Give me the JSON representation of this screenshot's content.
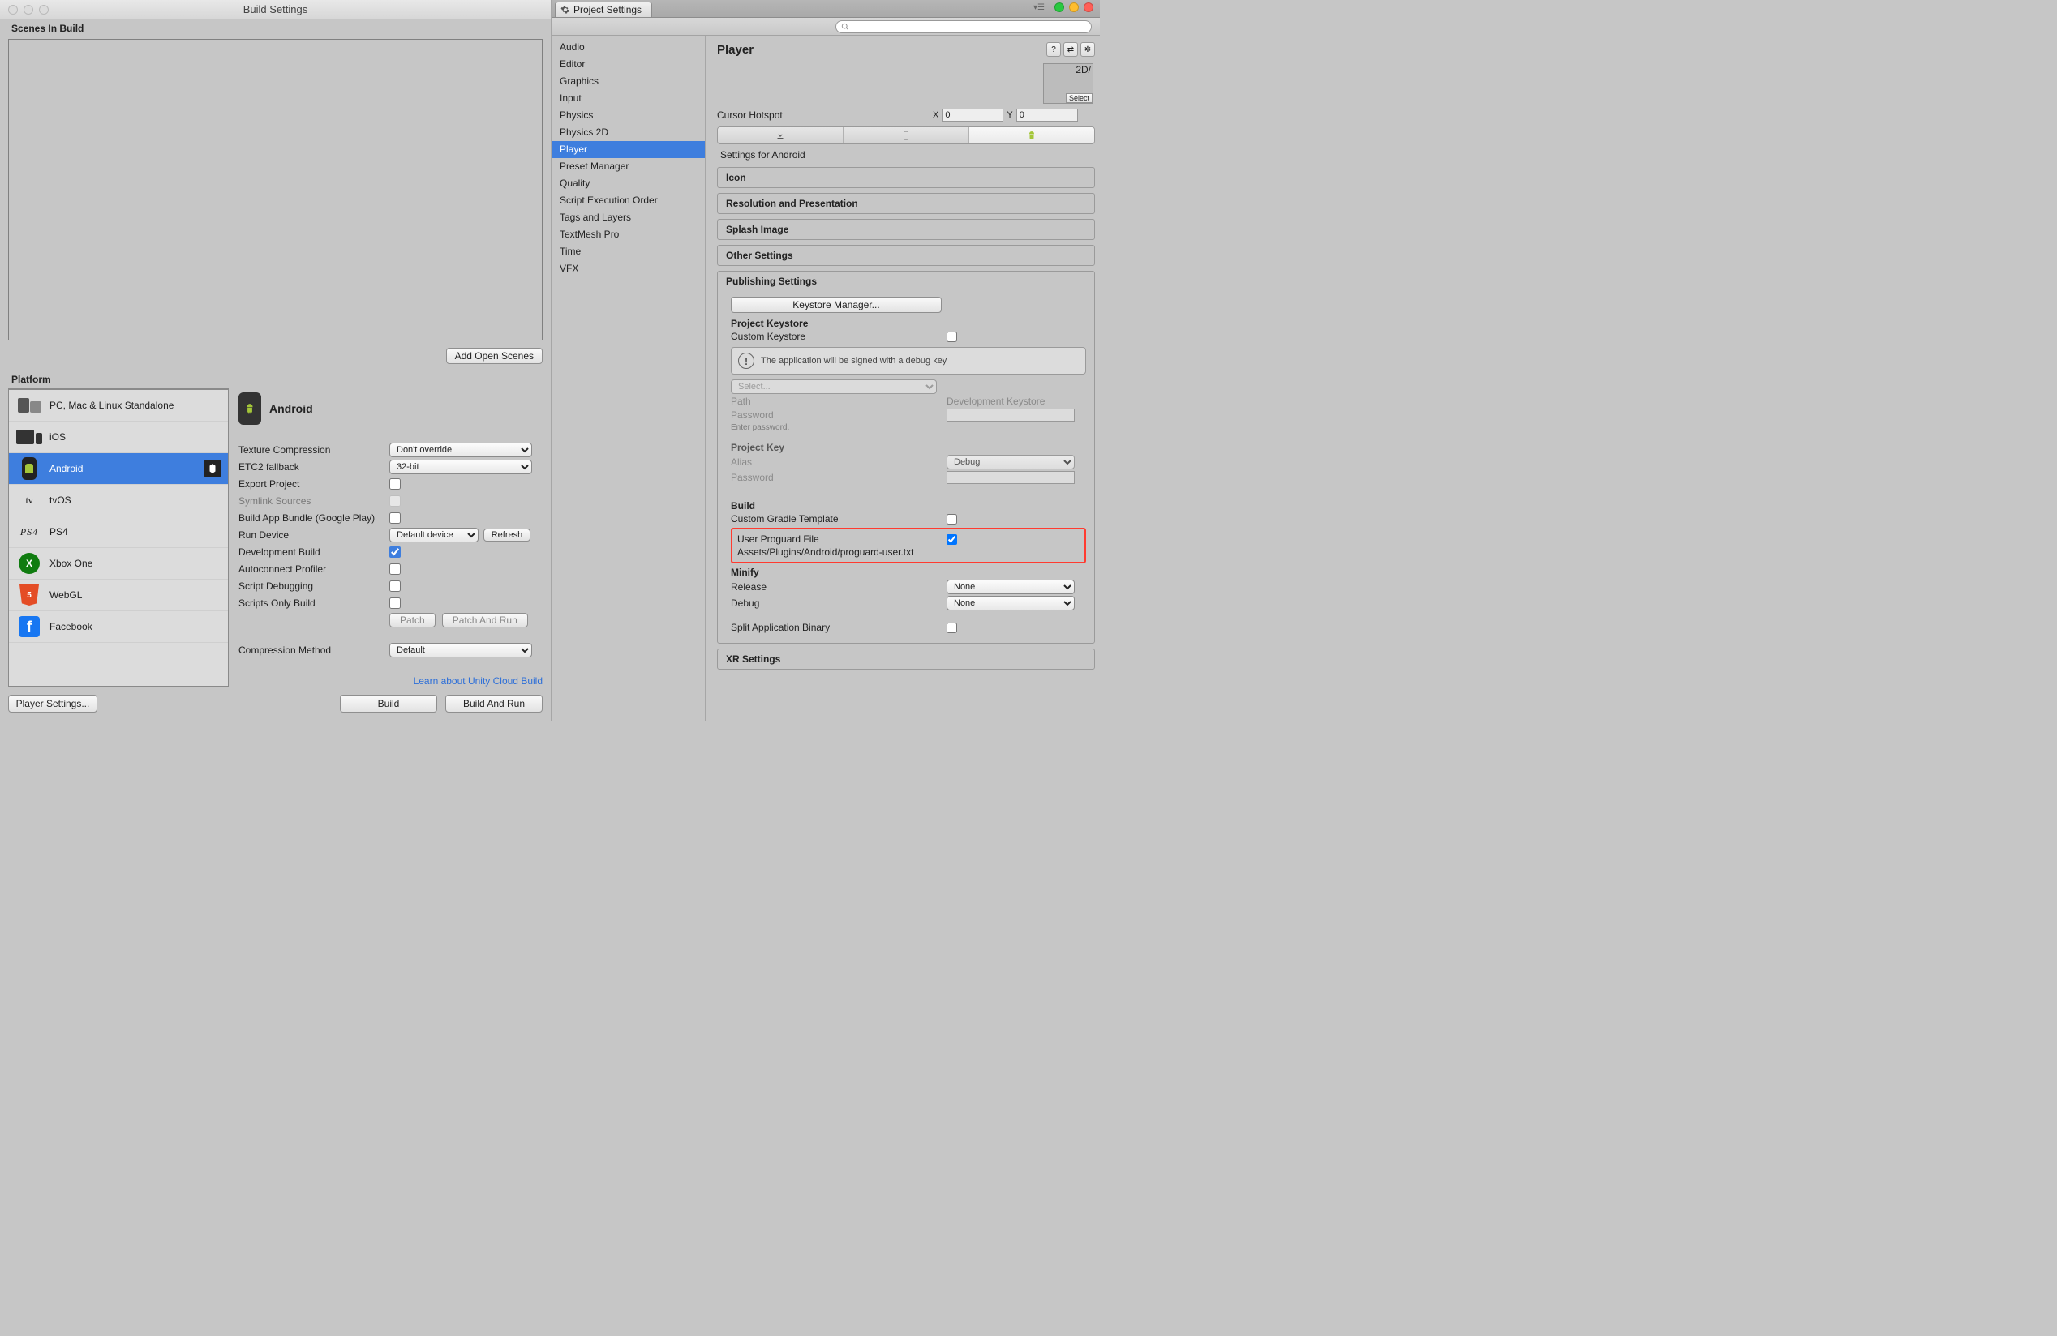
{
  "buildSettings": {
    "windowTitle": "Build Settings",
    "scenesLabel": "Scenes In Build",
    "addOpenScenes": "Add Open Scenes",
    "platformLabel": "Platform",
    "platforms": [
      {
        "label": "PC, Mac & Linux Standalone"
      },
      {
        "label": "iOS"
      },
      {
        "label": "Android"
      },
      {
        "label": "tvOS"
      },
      {
        "label": "PS4"
      },
      {
        "label": "Xbox One"
      },
      {
        "label": "WebGL"
      },
      {
        "label": "Facebook"
      }
    ],
    "selectedPlatform": "Android",
    "options": {
      "textureCompression": {
        "label": "Texture Compression",
        "value": "Don't override"
      },
      "etc2": {
        "label": "ETC2 fallback",
        "value": "32-bit"
      },
      "exportProject": {
        "label": "Export Project",
        "checked": false
      },
      "symlink": {
        "label": "Symlink Sources",
        "checked": false,
        "disabled": true
      },
      "aab": {
        "label": "Build App Bundle (Google Play)",
        "checked": false
      },
      "runDevice": {
        "label": "Run Device",
        "value": "Default device",
        "refresh": "Refresh"
      },
      "devBuild": {
        "label": "Development Build",
        "checked": true
      },
      "autoconnect": {
        "label": "Autoconnect Profiler",
        "checked": false
      },
      "scriptDebug": {
        "label": "Script Debugging",
        "checked": false
      },
      "scriptsOnly": {
        "label": "Scripts Only Build",
        "checked": false,
        "patch": "Patch",
        "patchRun": "Patch And Run"
      },
      "compression": {
        "label": "Compression Method",
        "value": "Default"
      }
    },
    "cloudLink": "Learn about Unity Cloud Build",
    "playerSettingsBtn": "Player Settings...",
    "buildBtn": "Build",
    "buildRunBtn": "Build And Run"
  },
  "projectSettings": {
    "tabLabel": "Project Settings",
    "categories": [
      "Audio",
      "Editor",
      "Graphics",
      "Input",
      "Physics",
      "Physics 2D",
      "Player",
      "Preset Manager",
      "Quality",
      "Script Execution Order",
      "Tags and Layers",
      "TextMesh Pro",
      "Time",
      "VFX"
    ],
    "selected": "Player",
    "player": {
      "title": "Player",
      "thumbLabel": "2D/",
      "thumbSelect": "Select",
      "cursorHotspot": {
        "label": "Cursor Hotspot",
        "x": "0",
        "y": "0"
      },
      "settingsFor": "Settings for Android",
      "foldouts": {
        "icon": "Icon",
        "resolution": "Resolution and Presentation",
        "splash": "Splash Image",
        "other": "Other Settings",
        "publishing": "Publishing Settings",
        "xr": "XR Settings"
      },
      "publishing": {
        "keystoreManager": "Keystore Manager...",
        "projectKeystore": "Project Keystore",
        "customKeystore": {
          "label": "Custom Keystore",
          "checked": false
        },
        "debugKeyMsg": "The application will be signed with a debug key",
        "selectDropdown": "Select...",
        "path": {
          "label": "Path",
          "value": "Development Keystore"
        },
        "password": {
          "label": "Password",
          "placeholder": "Enter password."
        },
        "projectKey": "Project Key",
        "alias": {
          "label": "Alias",
          "value": "Debug"
        },
        "aliasPassword": {
          "label": "Password"
        },
        "build": "Build",
        "customGradle": {
          "label": "Custom Gradle Template",
          "checked": false
        },
        "proguard": {
          "label": "User Proguard File",
          "checked": true,
          "path": "Assets/Plugins/Android/proguard-user.txt"
        },
        "minify": "Minify",
        "release": {
          "label": "Release",
          "value": "None"
        },
        "debug": {
          "label": "Debug",
          "value": "None"
        },
        "splitBinary": {
          "label": "Split Application Binary",
          "checked": false
        }
      }
    }
  }
}
